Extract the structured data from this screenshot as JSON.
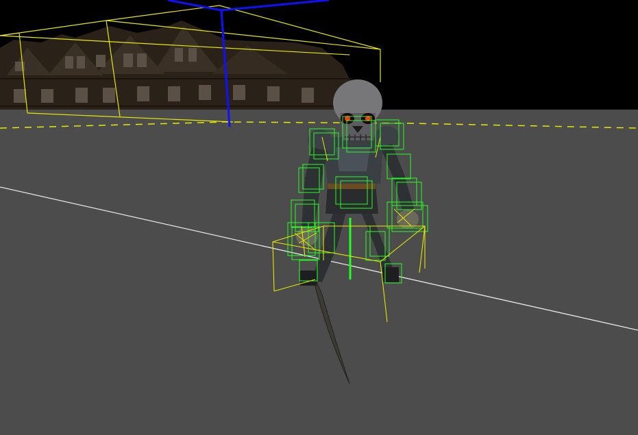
{
  "scene": {
    "colors": {
      "sky": "#000000",
      "ground": "#4c4c4c",
      "bbox_yellow": "#e8e800",
      "bone_green": "#22ff22",
      "axis_blue": "#1010ff",
      "floor_line": "#e8e8e8"
    },
    "objects": {
      "building": "tudor-house-row",
      "character": "skeleton-warrior",
      "weapon": "curved-sword"
    }
  }
}
